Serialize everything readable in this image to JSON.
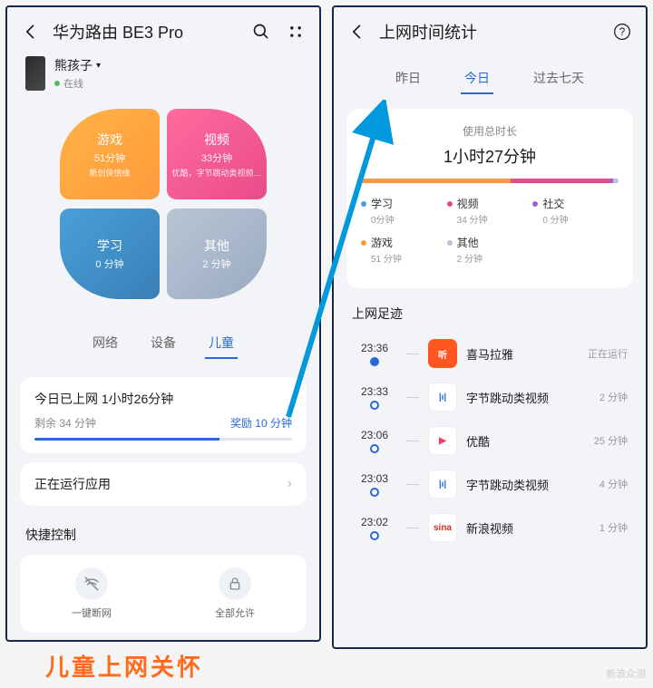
{
  "left": {
    "title": "华为路由 BE3 Pro",
    "device": {
      "name": "熊孩子",
      "status": "在线"
    },
    "petals": {
      "game": {
        "title": "游戏",
        "value": "51分钟",
        "sub": "新创侠情缘"
      },
      "video": {
        "title": "视频",
        "value": "33分钟",
        "sub": "优酷，字节跳动类视频…"
      },
      "study": {
        "title": "学习",
        "value": "0 分钟"
      },
      "other": {
        "title": "其他",
        "value": "2 分钟"
      }
    },
    "tabs": [
      "网络",
      "设备",
      "儿童"
    ],
    "usage": {
      "title": "今日已上网 1小时26分钟",
      "remaining": "剩余 34 分钟",
      "bonus": "奖励 10 分钟"
    },
    "running": "正在运行应用",
    "quick_title": "快捷控制",
    "controls": {
      "disconnect": "一键断网",
      "allow": "全部允许"
    }
  },
  "right": {
    "title": "上网时间统计",
    "tabs": [
      "昨日",
      "今日",
      "过去七天"
    ],
    "stat": {
      "title": "使用总时长",
      "total": "1小时27分钟"
    },
    "segments": [
      {
        "color": "#ff9a3c",
        "pct": 58
      },
      {
        "color": "#e94b8a",
        "pct": 39
      },
      {
        "color": "#9e5fd8",
        "pct": 1
      },
      {
        "color": "#b8c5d6",
        "pct": 2
      }
    ],
    "legend": [
      {
        "name": "学习",
        "value": "0分钟",
        "color": "#4a9fd8"
      },
      {
        "name": "视频",
        "value": "34 分钟",
        "color": "#e94b8a"
      },
      {
        "name": "社交",
        "value": "0 分钟",
        "color": "#9e5fd8"
      },
      {
        "name": "游戏",
        "value": "51 分钟",
        "color": "#ff9a3c"
      },
      {
        "name": "其他",
        "value": "2 分钟",
        "color": "#b8c5d6"
      }
    ],
    "footprint_title": "上网足迹",
    "footprints": [
      {
        "time": "23:36",
        "name": "喜马拉雅",
        "dur": "正在运行",
        "filled": true,
        "bg": "#ff5722",
        "txt": "听"
      },
      {
        "time": "23:33",
        "name": "字节跳动类视频",
        "dur": "2 分钟",
        "filled": false,
        "bg": "#fff",
        "txt": "|ı|",
        "tc": "#2868d8"
      },
      {
        "time": "23:06",
        "name": "优酷",
        "dur": "25 分钟",
        "filled": false,
        "bg": "#fff",
        "txt": "▶",
        "tc": "#ff3366"
      },
      {
        "time": "23:03",
        "name": "字节跳动类视频",
        "dur": "4 分钟",
        "filled": false,
        "bg": "#fff",
        "txt": "|ı|",
        "tc": "#2868d8"
      },
      {
        "time": "23:02",
        "name": "新浪视频",
        "dur": "1 分钟",
        "filled": false,
        "bg": "#fff",
        "txt": "sina",
        "tc": "#d52b1e"
      }
    ]
  },
  "caption": "儿童上网关怀",
  "watermark": "新浪众测"
}
